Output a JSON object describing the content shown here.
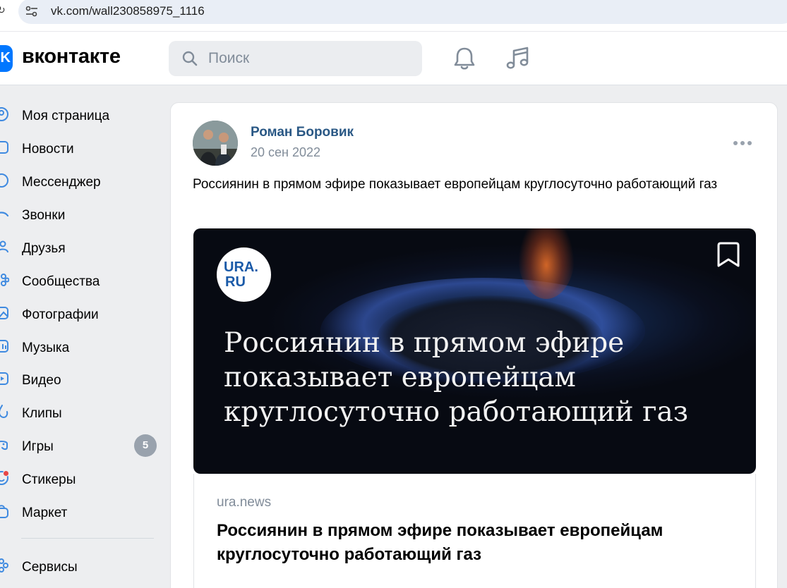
{
  "browser": {
    "url": "vk.com/wall230858975_1116"
  },
  "header": {
    "logo_text": "вконтакте",
    "logo_mark": "K",
    "search_placeholder": "Поиск",
    "icons": [
      "search-icon",
      "bell-icon",
      "music-icon"
    ]
  },
  "sidebar": {
    "items": [
      {
        "label": "Моя страница",
        "icon": "user-icon"
      },
      {
        "label": "Новости",
        "icon": "news-icon"
      },
      {
        "label": "Мессенджер",
        "icon": "message-icon"
      },
      {
        "label": "Звонки",
        "icon": "phone-icon"
      },
      {
        "label": "Друзья",
        "icon": "friends-icon"
      },
      {
        "label": "Сообщества",
        "icon": "communities-icon"
      },
      {
        "label": "Фотографии",
        "icon": "photo-icon"
      },
      {
        "label": "Музыка",
        "icon": "music-icon"
      },
      {
        "label": "Видео",
        "icon": "video-icon"
      },
      {
        "label": "Клипы",
        "icon": "clips-icon"
      },
      {
        "label": "Игры",
        "icon": "games-icon",
        "badge": "5"
      },
      {
        "label": "Стикеры",
        "icon": "stickers-icon"
      },
      {
        "label": "Маркет",
        "icon": "market-icon"
      },
      {
        "label": "Сервисы",
        "icon": "services-icon"
      }
    ]
  },
  "post": {
    "author": "Роман Боровик",
    "date": "20 сен 2022",
    "text": "Россиянин в прямом эфире показывает европейцам круглосуточно работающий газ",
    "media": {
      "logo_line1": "URA.",
      "logo_line2": "RU",
      "headline": "Россиянин в прямом эфире показывает европейцам круглосуточно работающий газ"
    },
    "link": {
      "domain": "ura.news",
      "title": "Россиянин в прямом эфире показывает европейцам круглосуточно работающий газ"
    }
  },
  "colors": {
    "accent": "#0077ff",
    "author_link": "#2a5885",
    "muted": "#818c99",
    "badge": "#99a2ad",
    "page_bg": "#edeef0"
  }
}
